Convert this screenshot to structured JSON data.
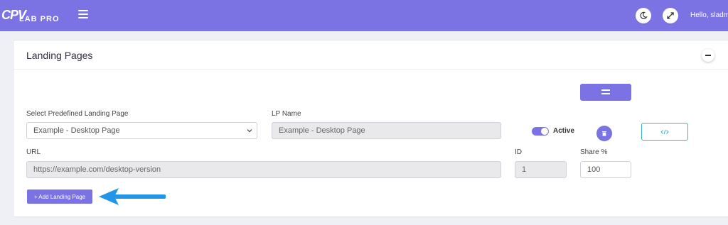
{
  "header": {
    "logo_big": "CPV",
    "logo_small": "LAB PRO",
    "greeting": "Hello, sladmi",
    "icons": {
      "menu": "hamburger-menu-icon",
      "theme": "moon-icon",
      "expand": "expand-arrows-icon"
    }
  },
  "card": {
    "title": "Landing Pages",
    "collapse_icon": "minus-icon"
  },
  "form": {
    "predefined_label": "Select Predefined Landing Page",
    "predefined_value": "Example - Desktop Page",
    "lp_name_label": "LP Name",
    "lp_name_value": "Example - Desktop Page",
    "active_label": "Active",
    "active_on": true,
    "url_label": "URL",
    "url_value": "https://example.com/desktop-version",
    "id_label": "ID",
    "id_value": "1",
    "share_label": "Share %",
    "share_value": "100",
    "add_button_label": "+ Add Landing Page"
  },
  "colors": {
    "accent": "#7b72e4",
    "code_button_border": "#3cb3c8",
    "arrow": "#2196e8"
  }
}
